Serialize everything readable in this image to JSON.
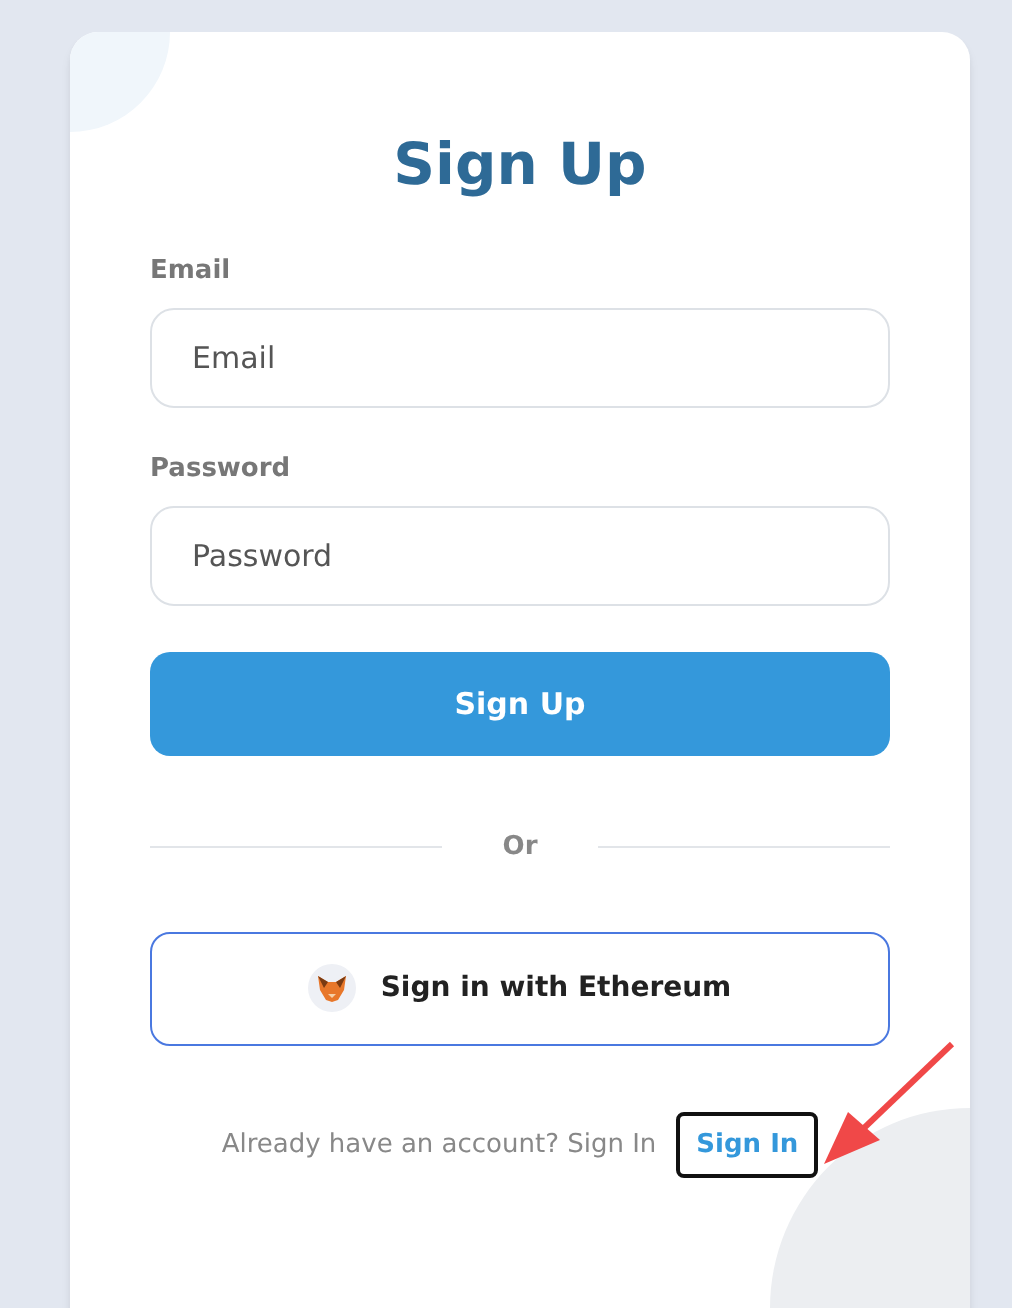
{
  "title": "Sign Up",
  "fields": [
    {
      "label": "Email",
      "placeholder": "Email"
    },
    {
      "label": "Password",
      "placeholder": "Password"
    }
  ],
  "submit": "Sign Up",
  "divider": "Or",
  "ethereum_button": "Sign in with Ethereum",
  "footer": {
    "text": "Already have an account? Sign In",
    "link": "Sign In",
    "link_focused": true
  }
}
